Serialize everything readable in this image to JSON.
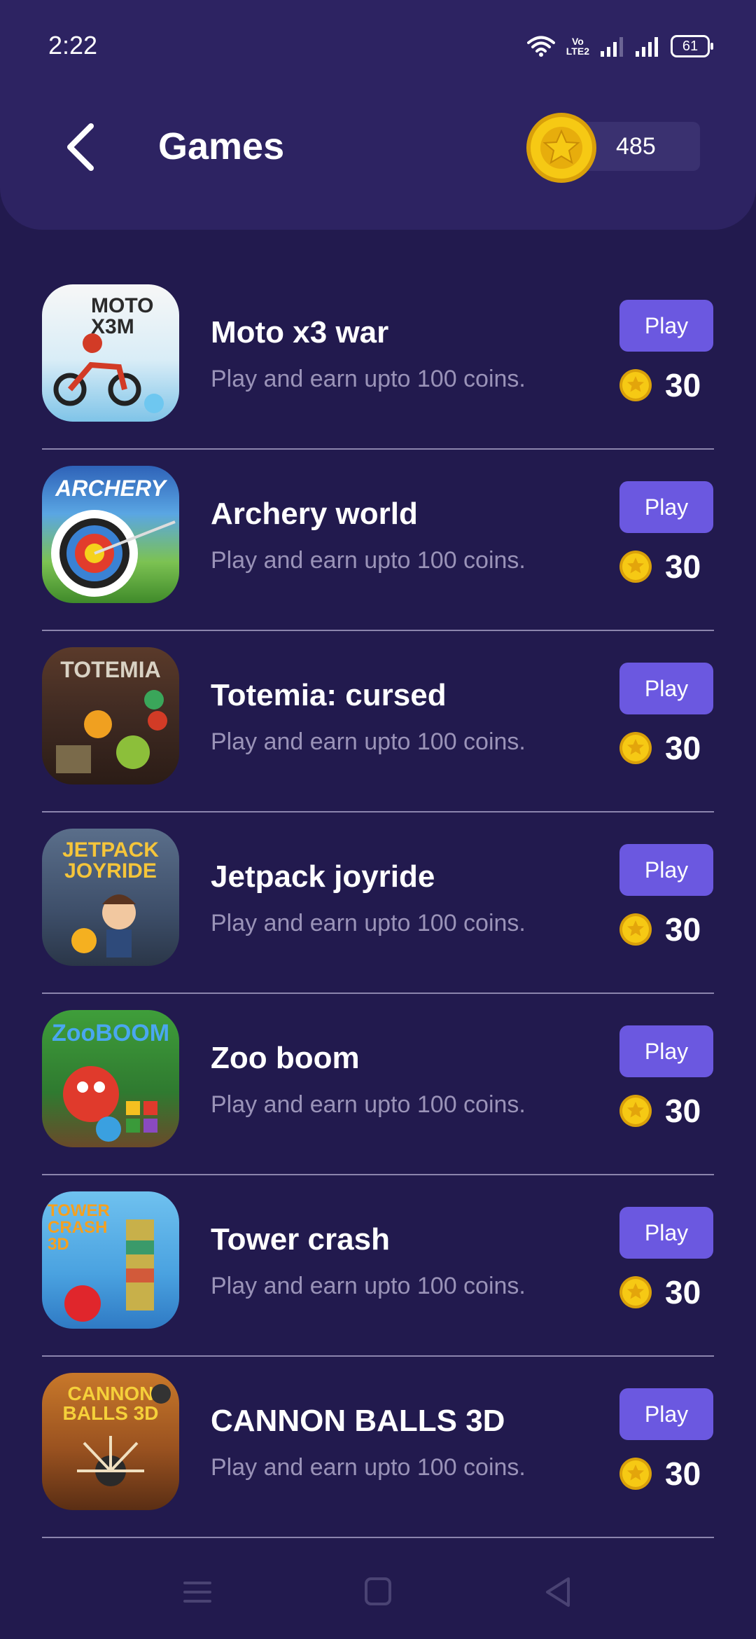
{
  "status_bar": {
    "time": "2:22",
    "volte_label_top": "Vo",
    "volte_label_bottom": "LTE2",
    "battery_level": "61"
  },
  "header": {
    "title": "Games",
    "coin_balance": "485"
  },
  "games": [
    {
      "name": "Moto x3 war",
      "description": "Play and earn upto 100 coins.",
      "play_label": "Play",
      "reward": "30",
      "art_text": "MOTO X3M"
    },
    {
      "name": "Archery world",
      "description": "Play and earn upto 100 coins.",
      "play_label": "Play",
      "reward": "30",
      "art_text": "ARCHERY"
    },
    {
      "name": "Totemia: cursed",
      "description": "Play and earn upto 100 coins.",
      "play_label": "Play",
      "reward": "30",
      "art_text": "TOTEMIA"
    },
    {
      "name": "Jetpack joyride",
      "description": "Play and earn upto 100 coins.",
      "play_label": "Play",
      "reward": "30",
      "art_text": "JETPACK JOYRIDE"
    },
    {
      "name": "Zoo boom",
      "description": "Play and earn upto 100 coins.",
      "play_label": "Play",
      "reward": "30",
      "art_text": "ZooBOOM"
    },
    {
      "name": "Tower crash",
      "description": "Play and earn upto 100 coins.",
      "play_label": "Play",
      "reward": "30",
      "art_text": "TOWER CRASH 3D"
    },
    {
      "name": "CANNON BALLS 3D",
      "description": "Play and earn upto 100 coins.",
      "play_label": "Play",
      "reward": "30",
      "art_text": "CANNON BALLS 3D"
    }
  ],
  "colors": {
    "background": "#221a4e",
    "header": "#2d2362",
    "play_button": "#6b58e0",
    "coin": "#f2c40f",
    "description_text": "#9a93b8"
  },
  "icons": {
    "back": "chevron-left-icon",
    "coin": "coin-star-icon",
    "nav_menu": "menu-icon",
    "nav_home": "home-square-icon",
    "nav_back": "back-triangle-icon"
  }
}
